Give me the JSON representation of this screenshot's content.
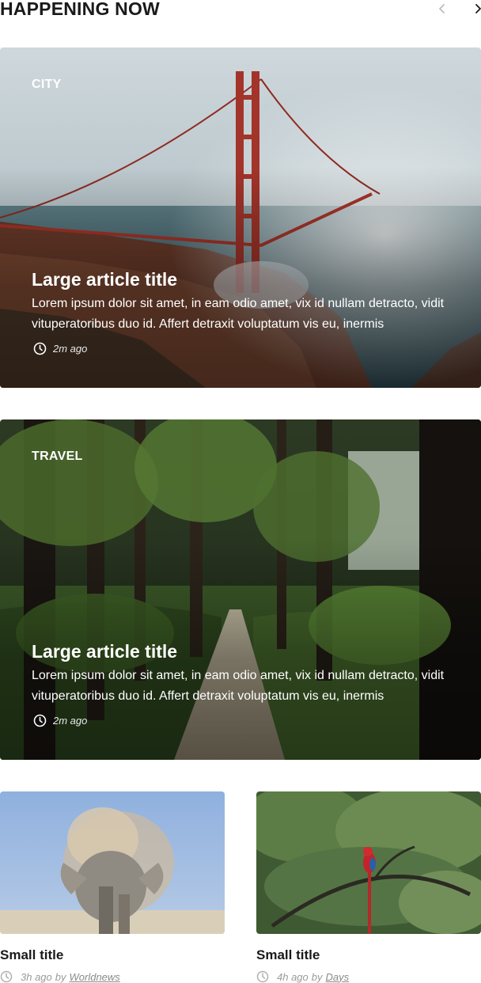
{
  "section": {
    "title": "HAPPENING NOW",
    "prev_icon": "chevron-left-icon",
    "next_icon": "chevron-right-icon"
  },
  "large_articles": [
    {
      "category": "CITY",
      "title": "Large article title",
      "excerpt": "Lorem ipsum dolor sit amet, in eam odio amet, vix id nullam detracto, vidit vituperatoribus duo id. Affert detraxit voluptatum vis eu, inermis",
      "time": "2m ago",
      "image": "golden-gate-bridge-fog"
    },
    {
      "category": "TRAVEL",
      "title": "Large article title",
      "excerpt": "Lorem ipsum dolor sit amet, in eam odio amet, vix id nullam detracto, vidit vituperatoribus duo id. Affert detraxit voluptatum vis eu, inermis",
      "time": "2m ago",
      "image": "forest-path"
    }
  ],
  "small_articles": [
    {
      "title": "Small title",
      "time": "3h ago",
      "by": "by",
      "author": "Worldnews",
      "image": "elephant-dust"
    },
    {
      "title": "Small title",
      "time": "4h ago",
      "by": "by",
      "author": "Days",
      "image": "red-parrot-in-tree"
    }
  ],
  "colors": {
    "text": "#1a1a1a",
    "meta": "#9a9a9a",
    "white": "#ffffff"
  }
}
